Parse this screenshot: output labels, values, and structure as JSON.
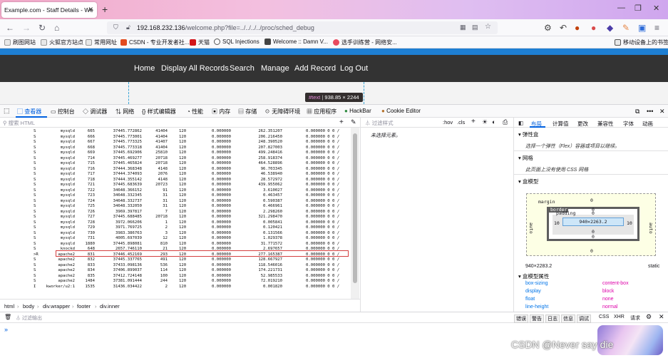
{
  "browser": {
    "tab_title": "Example.com - Staff Details - We",
    "new_tab": "+",
    "url_main": "192.168.232.136",
    "url_rest": "/welcome.php?file=../../../../proc/sched_debug",
    "bookmarks": [
      "刷图网站",
      "火狐官方站点",
      "常用网址",
      "CSDN - 专业开发者社...",
      "天猫",
      "SQL Injections",
      "Welcome :: Damn V...",
      "选手训练营 - 网络安..."
    ],
    "mobile_bookmarks": "移动设备上的书签"
  },
  "site": {
    "nav": [
      "Home",
      "Display All Records",
      "Search",
      "Manage",
      "Add Record",
      "Log Out"
    ],
    "tooltip_tag": "#text",
    "tooltip_size": "938.85 × 2244"
  },
  "devtools": {
    "tabs": [
      "查看器",
      "控制台",
      "调试器",
      "网络",
      "样式编辑器",
      "性能",
      "内存",
      "存储",
      "无障碍环境",
      "应用程序",
      "HackBar",
      "Cookie Editor"
    ],
    "search_placeholder": "搜索 HTML",
    "filter_styles": "过滤样式",
    "hov": ":hov",
    "cls": ".cls",
    "no_element": "未选择元素。",
    "layout_tabs": [
      "布局",
      "计算值",
      "更改",
      "兼容性",
      "字体",
      "动画"
    ],
    "flex_title": "弹性盒",
    "flex_hint": "选择一个弹性（Flex）容器或项目以继续。",
    "grid_title": "网格",
    "grid_hint": "此页面上没有使用 CSS 网格",
    "boxmodel_title": "盒模型",
    "bm_margin": "margin",
    "bm_border": "border",
    "bm_padding": "padding",
    "bm_content": "940×2263.2",
    "bm_zero": "0",
    "bm_ten": "10",
    "bm_auto": "auto",
    "dims": "940×2283.2",
    "position": "static",
    "props_title": "盒模型属性",
    "props": [
      {
        "name": "box-sizing",
        "value": "content-box"
      },
      {
        "name": "display",
        "value": "block"
      },
      {
        "name": "float",
        "value": "none"
      },
      {
        "name": "line-height",
        "value": "normal"
      }
    ],
    "breadcrumb": [
      "html",
      "body",
      "div.wrapper",
      "footer",
      "div.inner"
    ],
    "console_filter": "过滤输出",
    "console_levels": [
      "错误",
      "警告",
      "日志",
      "信息",
      "调试"
    ],
    "console_extra": [
      "CSS",
      "XHR",
      "请求"
    ],
    "console_prompt": "»"
  },
  "proc_rows": [
    {
      "s": "S",
      "task": "mysqld",
      "pid": "665",
      "tree": "37445.772862",
      "sw": "41404",
      "prio": "120",
      "ex": "0.000000",
      "sum": "262.351207",
      "slp": "0.000000 0 0 /"
    },
    {
      "s": "S",
      "task": "mysqld",
      "pid": "666",
      "tree": "37445.773001",
      "sw": "41404",
      "prio": "120",
      "ex": "0.000000",
      "sum": "206.216450",
      "slp": "0.000000 0 0 /"
    },
    {
      "s": "S",
      "task": "mysqld",
      "pid": "667",
      "tree": "37445.773325",
      "sw": "41407",
      "prio": "120",
      "ex": "0.000000",
      "sum": "248.390520",
      "slp": "0.000000 0 0 /"
    },
    {
      "s": "S",
      "task": "mysqld",
      "pid": "668",
      "tree": "37445.773318",
      "sw": "41404",
      "prio": "120",
      "ex": "0.000000",
      "sum": "207.827003",
      "slp": "0.000000 0 0 /"
    },
    {
      "s": "S",
      "task": "mysqld",
      "pid": "669",
      "tree": "37445.692906",
      "sw": "25810",
      "prio": "120",
      "ex": "0.000000",
      "sum": "499.248416",
      "slp": "0.000000 0 0 /"
    },
    {
      "s": "S",
      "task": "mysqld",
      "pid": "714",
      "tree": "37445.469277",
      "sw": "20718",
      "prio": "120",
      "ex": "0.000000",
      "sum": "258.918374",
      "slp": "0.000000 0 0 /"
    },
    {
      "s": "S",
      "task": "mysqld",
      "pid": "715",
      "tree": "37445.465824",
      "sw": "20718",
      "prio": "120",
      "ex": "0.000000",
      "sum": "464.528896",
      "slp": "0.000000 0 0 /"
    },
    {
      "s": "S",
      "task": "mysqld",
      "pid": "716",
      "tree": "37444.368348",
      "sw": "4148",
      "prio": "120",
      "ex": "0.000000",
      "sum": "96.703345",
      "slp": "0.000000 0 0 /"
    },
    {
      "s": "S",
      "task": "mysqld",
      "pid": "717",
      "tree": "37444.374093",
      "sw": "2076",
      "prio": "120",
      "ex": "0.000000",
      "sum": "46.538940",
      "slp": "0.000000 0 0 /"
    },
    {
      "s": "S",
      "task": "mysqld",
      "pid": "718",
      "tree": "37444.355142",
      "sw": "4148",
      "prio": "120",
      "ex": "0.000000",
      "sum": "28.572972",
      "slp": "0.000000 0 0 /"
    },
    {
      "s": "S",
      "task": "mysqld",
      "pid": "721",
      "tree": "37445.683639",
      "sw": "20723",
      "prio": "120",
      "ex": "0.000000",
      "sum": "439.955062",
      "slp": "0.000000 0 0 /"
    },
    {
      "s": "S",
      "task": "mysqld",
      "pid": "722",
      "tree": "34648.366152",
      "sw": "91",
      "prio": "120",
      "ex": "0.000000",
      "sum": "3.610027",
      "slp": "0.000000 0 0 /"
    },
    {
      "s": "S",
      "task": "mysqld",
      "pid": "723",
      "tree": "34648.332345",
      "sw": "31",
      "prio": "120",
      "ex": "0.000000",
      "sum": "0.463457",
      "slp": "0.000000 0 0 /"
    },
    {
      "s": "S",
      "task": "mysqld",
      "pid": "724",
      "tree": "34648.332737",
      "sw": "31",
      "prio": "120",
      "ex": "0.000000",
      "sum": "0.590387",
      "slp": "0.000000 0 0 /"
    },
    {
      "s": "S",
      "task": "mysqld",
      "pid": "725",
      "tree": "34648.332050",
      "sw": "31",
      "prio": "120",
      "ex": "0.000000",
      "sum": "0.466961",
      "slp": "0.000000 0 0 /"
    },
    {
      "s": "S",
      "task": "mysqld",
      "pid": "726",
      "tree": "3969.397817",
      "sw": "7",
      "prio": "120",
      "ex": "0.000000",
      "sum": "2.298260",
      "slp": "0.000000 0 0 /"
    },
    {
      "s": "S",
      "task": "mysqld",
      "pid": "727",
      "tree": "37445.688485",
      "sw": "20718",
      "prio": "120",
      "ex": "0.000000",
      "sum": "321.298470",
      "slp": "0.000000 0 0 /"
    },
    {
      "s": "S",
      "task": "mysqld",
      "pid": "728",
      "tree": "3972.066206",
      "sw": "1",
      "prio": "120",
      "ex": "0.000000",
      "sum": "0.005841",
      "slp": "0.000000 0 0 /"
    },
    {
      "s": "S",
      "task": "mysqld",
      "pid": "729",
      "tree": "3971.769725",
      "sw": "2",
      "prio": "120",
      "ex": "0.000000",
      "sum": "0.120421",
      "slp": "0.000000 0 0 /"
    },
    {
      "s": "S",
      "task": "mysqld",
      "pid": "730",
      "tree": "3983.386763",
      "sw": "3",
      "prio": "120",
      "ex": "0.000000",
      "sum": "0.131566",
      "slp": "0.000000 0 0 /"
    },
    {
      "s": "S",
      "task": "mysqld",
      "pid": "731",
      "tree": "4005.697039",
      "sw": "12",
      "prio": "120",
      "ex": "0.000000",
      "sum": "1.029378",
      "slp": "0.000000 0 0 /"
    },
    {
      "s": "S",
      "task": "mysqld",
      "pid": "1880",
      "tree": "37445.898081",
      "sw": "810",
      "prio": "120",
      "ex": "0.000000",
      "sum": "31.771572",
      "slp": "0.000000 0 0 /"
    },
    {
      "s": "S",
      "task": "knockd",
      "pid": "648",
      "tree": "2657.746110",
      "sw": "21",
      "prio": "120",
      "ex": "0.000000",
      "sum": "2.697657",
      "slp": "0.000000 0 0 /"
    },
    {
      "s": ">R",
      "task": "apache2",
      "pid": "831",
      "tree": "37446.452169",
      "sw": "293",
      "prio": "120",
      "ex": "0.000000",
      "sum": "277.165387",
      "slp": "0.000000 0 0 /"
    },
    {
      "s": "S",
      "task": "apache2",
      "pid": "832",
      "tree": "37445.337765",
      "sw": "491",
      "prio": "120",
      "ex": "0.000000",
      "sum": "128.667927",
      "slp": "0.000000 0 0 /"
    },
    {
      "s": "S",
      "task": "apache2",
      "pid": "833",
      "tree": "37433.098136",
      "sw": "536",
      "prio": "120",
      "ex": "0.000000",
      "sum": "118.546016",
      "slp": "0.000000 0 0 /"
    },
    {
      "s": "S",
      "task": "apache2",
      "pid": "834",
      "tree": "37406.899037",
      "sw": "114",
      "prio": "120",
      "ex": "0.000000",
      "sum": "174.221731",
      "slp": "0.000000 0 0 /"
    },
    {
      "s": "S",
      "task": "apache2",
      "pid": "835",
      "tree": "37412.724148",
      "sw": "100",
      "prio": "120",
      "ex": "0.000000",
      "sum": "52.985533",
      "slp": "0.000000 0 0 /"
    },
    {
      "s": "S",
      "task": "apache2",
      "pid": "1484",
      "tree": "37381.091444",
      "sw": "244",
      "prio": "120",
      "ex": "0.000000",
      "sum": "72.019210",
      "slp": "0.000000 0 0 /"
    },
    {
      "s": "I",
      "task": "kworker/u2:1",
      "pid": "1535",
      "tree": "31436.034422",
      "sw": "2",
      "prio": "120",
      "ex": "0.000000",
      "sum": "0.001820",
      "slp": "0.000000 0 0 /"
    }
  ],
  "watermark": "CSDN @Never say die",
  "colors": {
    "accent": "#0060df",
    "page_blue": "#1e7fd3",
    "highlight": "#d43f3f"
  }
}
